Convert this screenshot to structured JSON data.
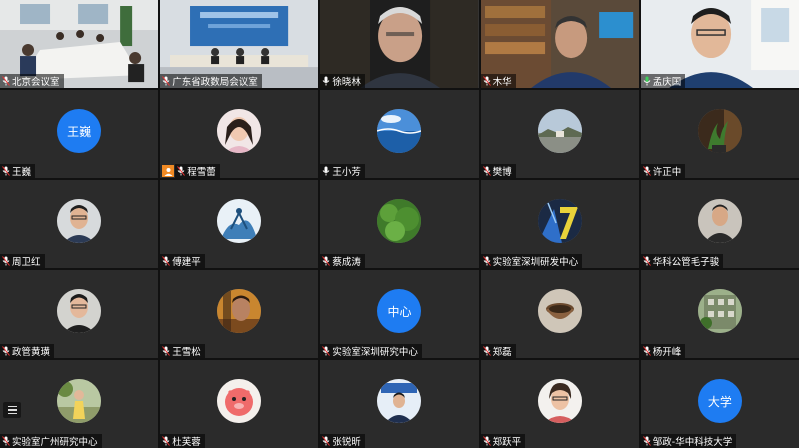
{
  "participants": {
    "r1": [
      {
        "name": "北京会议室"
      },
      {
        "name": "广东省政数局会议室"
      },
      {
        "name": "徐晓林"
      },
      {
        "name": "木华"
      },
      {
        "name": "孟庆国"
      }
    ],
    "r2": [
      {
        "name": "王巍",
        "initials": "王巍"
      },
      {
        "name": "程雪蕾"
      },
      {
        "name": "王小芳"
      },
      {
        "name": "樊博"
      },
      {
        "name": "许正中"
      }
    ],
    "r3": [
      {
        "name": "周卫红"
      },
      {
        "name": "傅建平"
      },
      {
        "name": "蔡成涛"
      },
      {
        "name": "实验室深圳研发中心"
      },
      {
        "name": "华科公管毛子骏"
      }
    ],
    "r4": [
      {
        "name": "政管黄璜"
      },
      {
        "name": "王雪松"
      },
      {
        "name": "实验室深圳研究中心",
        "initials": "中心"
      },
      {
        "name": "郑磊"
      },
      {
        "name": "杨开峰"
      }
    ],
    "r5": [
      {
        "name": "实验室广州研究中心"
      },
      {
        "name": "杜芙蓉"
      },
      {
        "name": "张锐昕"
      },
      {
        "name": "郑跃平"
      },
      {
        "name": "邹政-华中科技大学",
        "initials": "大学"
      }
    ]
  },
  "colors": {
    "avatar_blue": "#1e7cf2",
    "host_badge": "#f08a24",
    "tile_bg": "#2b2b2b"
  }
}
